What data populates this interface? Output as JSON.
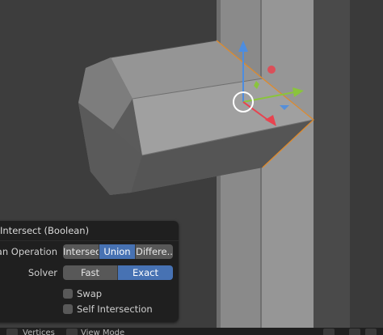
{
  "operator_panel": {
    "title": "Intersect (Boolean)",
    "boolean_operation": {
      "label": "Boolean Operation",
      "options": [
        "Intersect",
        "Union",
        "Difference"
      ],
      "options_visible": [
        "Intersect",
        "Union",
        "Differe..."
      ],
      "selected": "Union"
    },
    "solver": {
      "label": "Solver",
      "options": [
        "Fast",
        "Exact"
      ],
      "selected": "Exact"
    },
    "swap": {
      "label": "Swap",
      "checked": false
    },
    "self_intersection": {
      "label": "Self Intersection",
      "checked": false
    }
  },
  "status_bar": {
    "item1": "Vertices",
    "item2": "View Mode"
  },
  "colors": {
    "viewport_bg": "#3d3d3d",
    "selected_button": "#4772b3",
    "button": "#585858",
    "panel_bg": "#1e1e1e",
    "gizmo_x": "#e8434f",
    "gizmo_y": "#8ac43d",
    "gizmo_z": "#4d8de0",
    "selection_edge": "#e08a2a"
  },
  "icons": [
    "transform-gizmo-icon",
    "checkbox-icon",
    "mouse-icon"
  ]
}
